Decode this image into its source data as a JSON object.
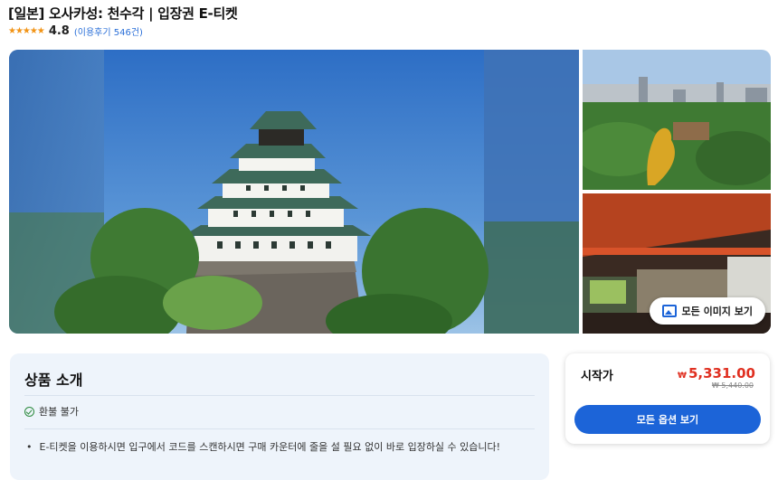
{
  "product": {
    "title": "[일본] 오사카성: 천수각 | 입장권 E-티켓",
    "stars": "★★★★★",
    "rating": "4.8",
    "reviews": "(이용후기 546건)"
  },
  "gallery": {
    "view_all_label": "모든 이미지 보기",
    "view_all_icon": "image-icon"
  },
  "intro": {
    "title": "상품 소개",
    "refund_icon": "check-circle-icon",
    "refund": "환불 불가",
    "bullets": [
      "E-티켓을 이용하시면 입구에서 코드를 스캔하시면 구매 카운터에 줄을 설 필요 없이 바로 입장하실 수 있습니다!"
    ]
  },
  "pricing": {
    "start_label": "시작가",
    "currency_symbol": "₩",
    "price": "5,331.00",
    "original_price": "₩ 5,440.00",
    "options_button": "모든 옵션 보기"
  },
  "colors": {
    "accent": "#1c64d8",
    "price": "#e03021",
    "stars": "#f29416"
  }
}
